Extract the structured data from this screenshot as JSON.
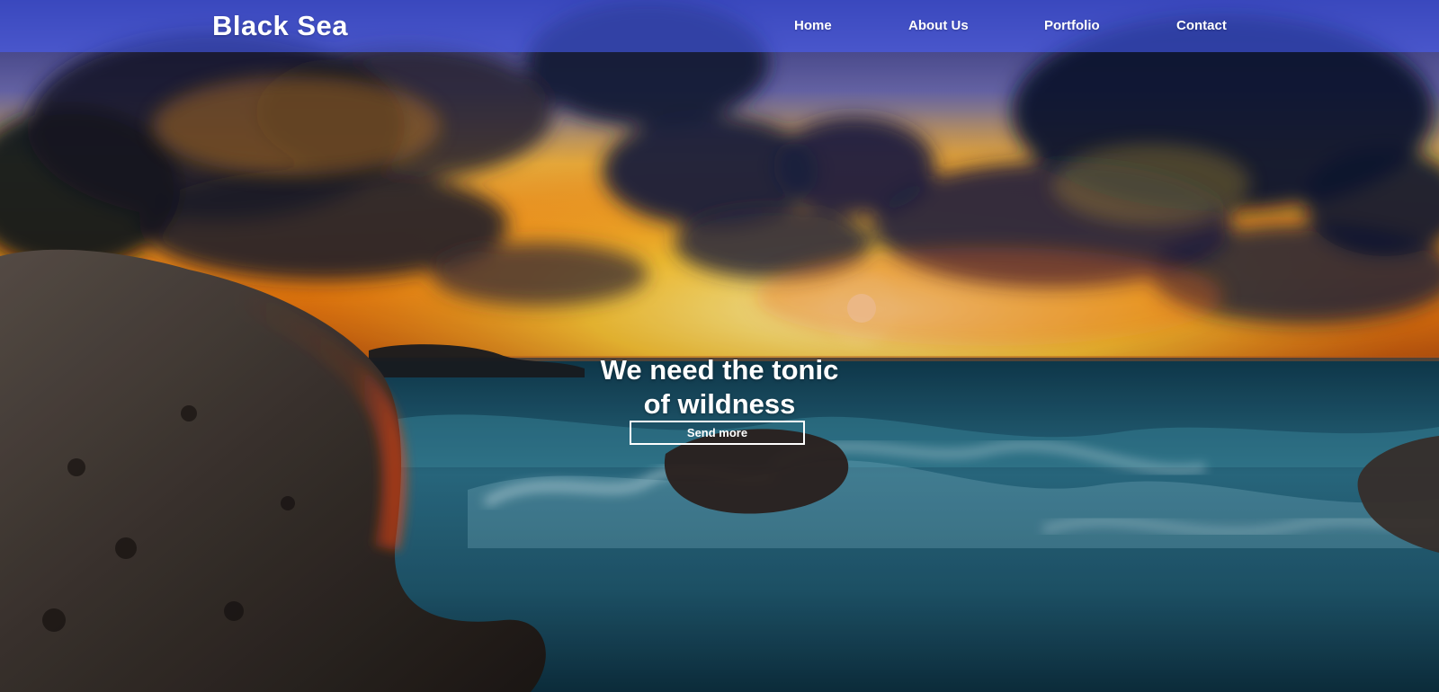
{
  "colors": {
    "navbar_overlay": "#4860FF",
    "text": "#FFFFFF",
    "sky_highlight": "#FFD21A",
    "sea": "#2B6E86"
  },
  "header": {
    "brand": "Black Sea",
    "nav": [
      {
        "label": "Home"
      },
      {
        "label": "About Us"
      },
      {
        "label": "Portfolio"
      },
      {
        "label": "Contact"
      }
    ]
  },
  "hero": {
    "background_description_hidden": "",
    "headline_line1": "We need the tonic",
    "headline_line2": "of wildness",
    "button_label": "Send more"
  }
}
